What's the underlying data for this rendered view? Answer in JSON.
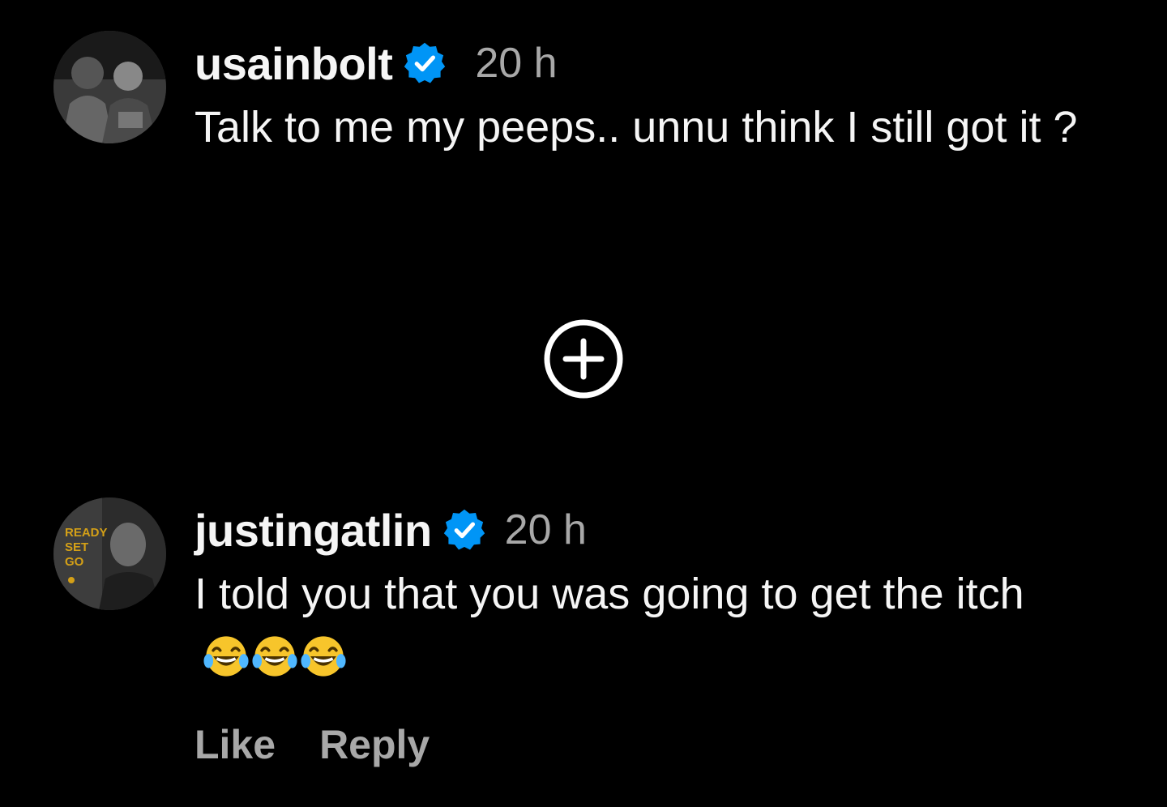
{
  "comments": [
    {
      "username": "usainbolt",
      "verified": true,
      "time": "20 h",
      "text": "Talk to me my peeps.. unnu think I still got it ?",
      "avatar_icon": "avatar-photo"
    },
    {
      "username": "justingatlin",
      "verified": true,
      "time": "20 h",
      "text": "I told you that you was going to get the itch",
      "emoji": "😂😂😂",
      "avatar_icon": "avatar-photo",
      "avatar_overlay_text": "READY SET GO",
      "actions": {
        "like": "Like",
        "reply": "Reply"
      }
    }
  ],
  "load_more_icon": "plus-circle-icon",
  "colors": {
    "background": "#000000",
    "text": "#f5f5f5",
    "secondary": "#a8a8a8",
    "verified": "#0095f6",
    "avatar_gold": "#d4a017"
  }
}
